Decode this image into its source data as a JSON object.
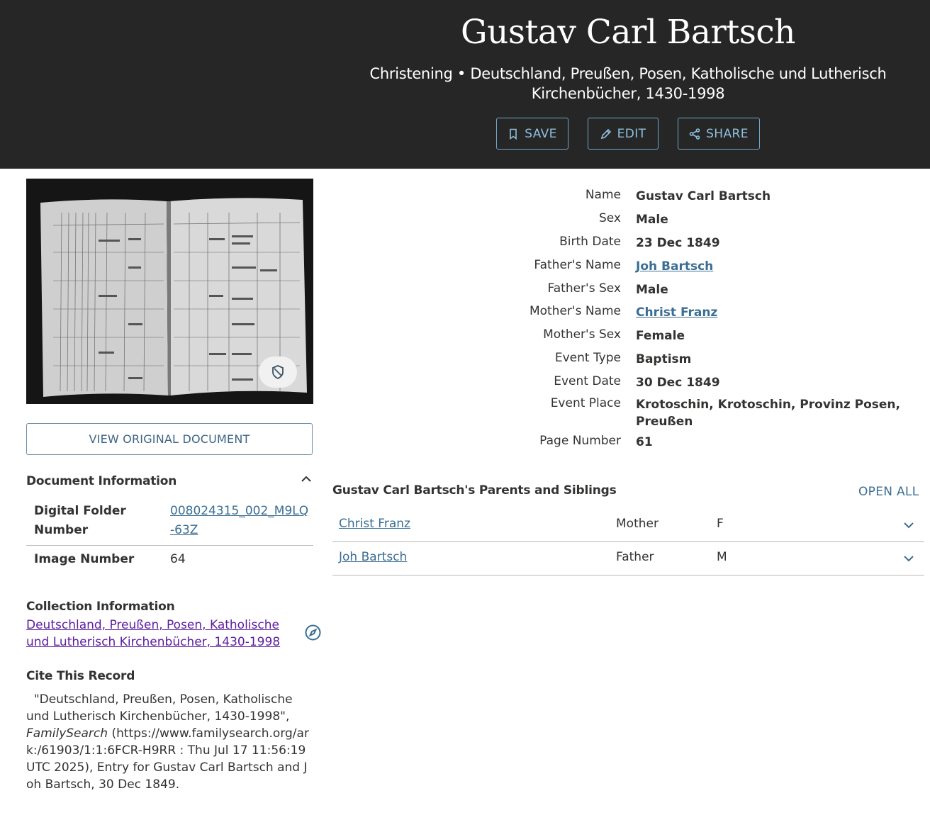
{
  "header": {
    "title": "Gustav Carl Bartsch",
    "subtitle": "Christening • Deutschland, Preußen, Posen, Katholische und Lutherisch Kirchenbücher, 1430-1998",
    "buttons": {
      "save": "SAVE",
      "edit": "EDIT",
      "share": "SHARE"
    }
  },
  "image": {
    "view_button": "VIEW ORIGINAL DOCUMENT"
  },
  "document_info": {
    "title": "Document Information",
    "rows": [
      {
        "label": "Digital Folder Number",
        "value": "008024315_002_M9LQ-63Z"
      },
      {
        "label": "Image Number",
        "value": "64"
      }
    ]
  },
  "collection_info": {
    "title": "Collection Information",
    "link": "Deutschland, Preußen, Posen, Katholische und Lutherisch Kirchenbücher, 1430-1998"
  },
  "cite": {
    "title": "Cite This Record",
    "part1": "\"Deutschland, Preußen, Posen, Katholische und Lutherisch Kirchenbücher, 1430-1998\",",
    "italic": "FamilySearch",
    "part2": "(https://www.familysearch.org/ark:/61903/1:1:6FCR-H9RR : Thu Jul 17 11:56:19 UTC 2025), Entry for Gustav Carl Bartsch and Joh Bartsch, 30 Dec 1849."
  },
  "facts": [
    {
      "label": "Name",
      "value": "Gustav Carl Bartsch"
    },
    {
      "label": "Sex",
      "value": "Male"
    },
    {
      "label": "Birth Date",
      "value": "23 Dec 1849"
    },
    {
      "label": "Father's Name",
      "value": "Joh Bartsch"
    },
    {
      "label": "Father's Sex",
      "value": "Male"
    },
    {
      "label": "Mother's Name",
      "value": "Christ Franz"
    },
    {
      "label": "Mother's Sex",
      "value": "Female"
    },
    {
      "label": "Event Type",
      "value": "Baptism"
    },
    {
      "label": "Event Date",
      "value": "30 Dec 1849"
    },
    {
      "label": "Event Place",
      "value": "Krotoschin, Krotoschin, Provinz Posen, Preußen"
    },
    {
      "label": "Page Number",
      "value": "61"
    }
  ],
  "family": {
    "title": "Gustav Carl Bartsch's Parents and Siblings",
    "open_all": "OPEN ALL",
    "members": [
      {
        "name": "Christ Franz",
        "relation": "Mother",
        "sex": "F"
      },
      {
        "name": "Joh Bartsch",
        "relation": "Father",
        "sex": "M"
      }
    ]
  }
}
